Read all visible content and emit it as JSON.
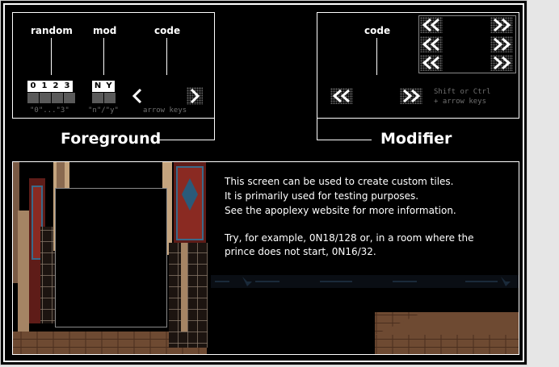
{
  "foreground": {
    "title": "Foreground",
    "random_label": "random",
    "mod_label": "mod",
    "code_label": "code",
    "random_digits": [
      "0",
      "1",
      "2",
      "3"
    ],
    "mod_letters": [
      "N",
      "Y"
    ],
    "random_hint": "\"0\"...\"3\"",
    "mod_hint": "\"n\"/\"y\"",
    "code_hint": "arrow keys"
  },
  "modifier": {
    "title": "Modifier",
    "code_label": "code",
    "hint_line1": "Shift or Ctrl",
    "hint_line2": "+ arrow keys"
  },
  "info": {
    "line1": "This screen can be used to create custom tiles.",
    "line2": "It is primarily used for testing purposes.",
    "line3": "See the apoplexy website for more information.",
    "line4": "Try, for example, 0N18/128 or, in a room where the",
    "line5": "prince does not start, 0N16/32."
  },
  "colors": {
    "background": "#000000",
    "text": "#ffffff",
    "hint": "#6f6f6f",
    "slot": "#5a5a5a"
  },
  "icons": {
    "left_arrow": "chevron-left-icon",
    "right_arrow": "chevron-right-icon",
    "double_left": "double-chevron-left-icon",
    "double_right": "double-chevron-right-icon"
  }
}
